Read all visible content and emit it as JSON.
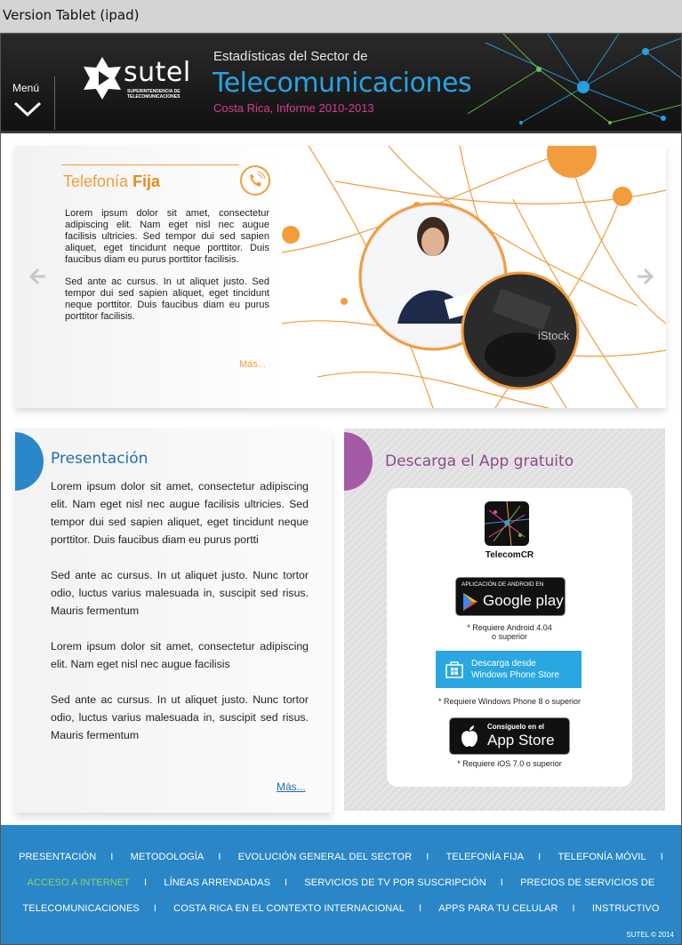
{
  "tag_label": "Version Tablet (ipad)",
  "header": {
    "menu_label": "Menú",
    "logo_name": "sutel",
    "logo_sub": "SUPERINTENDENCIA DE TELECOMUNICACIONES",
    "pre_title": "Estadísticas del Sector de",
    "main_title": "Telecomunicaciones",
    "subtitle": "Costa Rica, Informe 2010-2013"
  },
  "hero": {
    "title_a": "Telefonía ",
    "title_b": "Fija",
    "para1": "Lorem ipsum dolor sit amet, consectetur adipiscing elit. Nam eget nisl nec augue facilisis ultricies. Sed tempor dui sed sapien aliquet, eget tincidunt neque porttitor. Duis faucibus diam eu purus porttitor facilisis.",
    "para2": "Sed ante ac cursus. In ut aliquet justo. Sed tempor dui sed sapien aliquet, eget tincidunt neque porttitor. Duis faucibus diam eu purus porttitor facilisis.",
    "more": "Más...",
    "photo_watermark": "iStock"
  },
  "presentation": {
    "title": "Presentación",
    "p1": "Lorem ipsum dolor sit amet, consectetur adipiscing elit. Nam eget nisl nec augue facilisis ultricies. Sed tempor dui sed sapien aliquet, eget tincidunt neque porttitor. Duis faucibus diam eu purus portti",
    "p2": "Sed ante ac cursus. In ut aliquet justo. Nunc tortor odio, luctus varius malesuada in, suscipit sed risus. Mauris fermentum",
    "p3": "Lorem ipsum dolor sit amet, consectetur adipiscing elit. Nam eget nisl nec augue facilisis",
    "p4": "Sed ante ac cursus. In ut aliquet justo. Nunc tortor odio, luctus varius malesuada in, suscipit sed risus. Mauris fermentum",
    "more": "Más..."
  },
  "app": {
    "title": "Descarga el App gratuito",
    "app_name": "TelecomCR",
    "google_small": "APLICACIÓN DE ANDROID EN",
    "google_big": "Google play",
    "req_android_1": "* Requiere Android 4.04",
    "req_android_2": "o superior",
    "wp_line1": "Descarga desde",
    "wp_line2": "Windows Phone Store",
    "req_wp": "* Requiere Windows Phone 8 o superior",
    "apple_small": "Consíguelo en el",
    "apple_big": "App Store",
    "req_ios": "* Requiere iOS 7.0 o superior"
  },
  "footer": {
    "row1": [
      "PRESENTACIÓN",
      "METODOLOGÍA",
      "EVOLUCIÓN GENERAL DEL SECTOR",
      "TELEFONÍA FIJA",
      "TELEFONÍA MÓVIL"
    ],
    "row2": [
      "ACCESO A INTERNET",
      "LÍNEAS ARRENDADAS",
      "SERVICIOS DE TV POR SUSCRIPCIÓN",
      "PRECIOS DE SERVICIOS DE"
    ],
    "row3": [
      "TELECOMUNICACIONES",
      "COSTA RICA EN EL CONTEXTO INTERNACIONAL",
      "APPS PARA TU CELULAR",
      "INSTRUCTIVO"
    ],
    "separator": "I",
    "copyright": "SUTEL ©  2014"
  },
  "colors": {
    "accent_blue": "#2a86c6",
    "orange": "#f39c3b",
    "magenta": "#d63c95",
    "purple": "#a45aa4",
    "active_nav": "#8fd36a"
  }
}
